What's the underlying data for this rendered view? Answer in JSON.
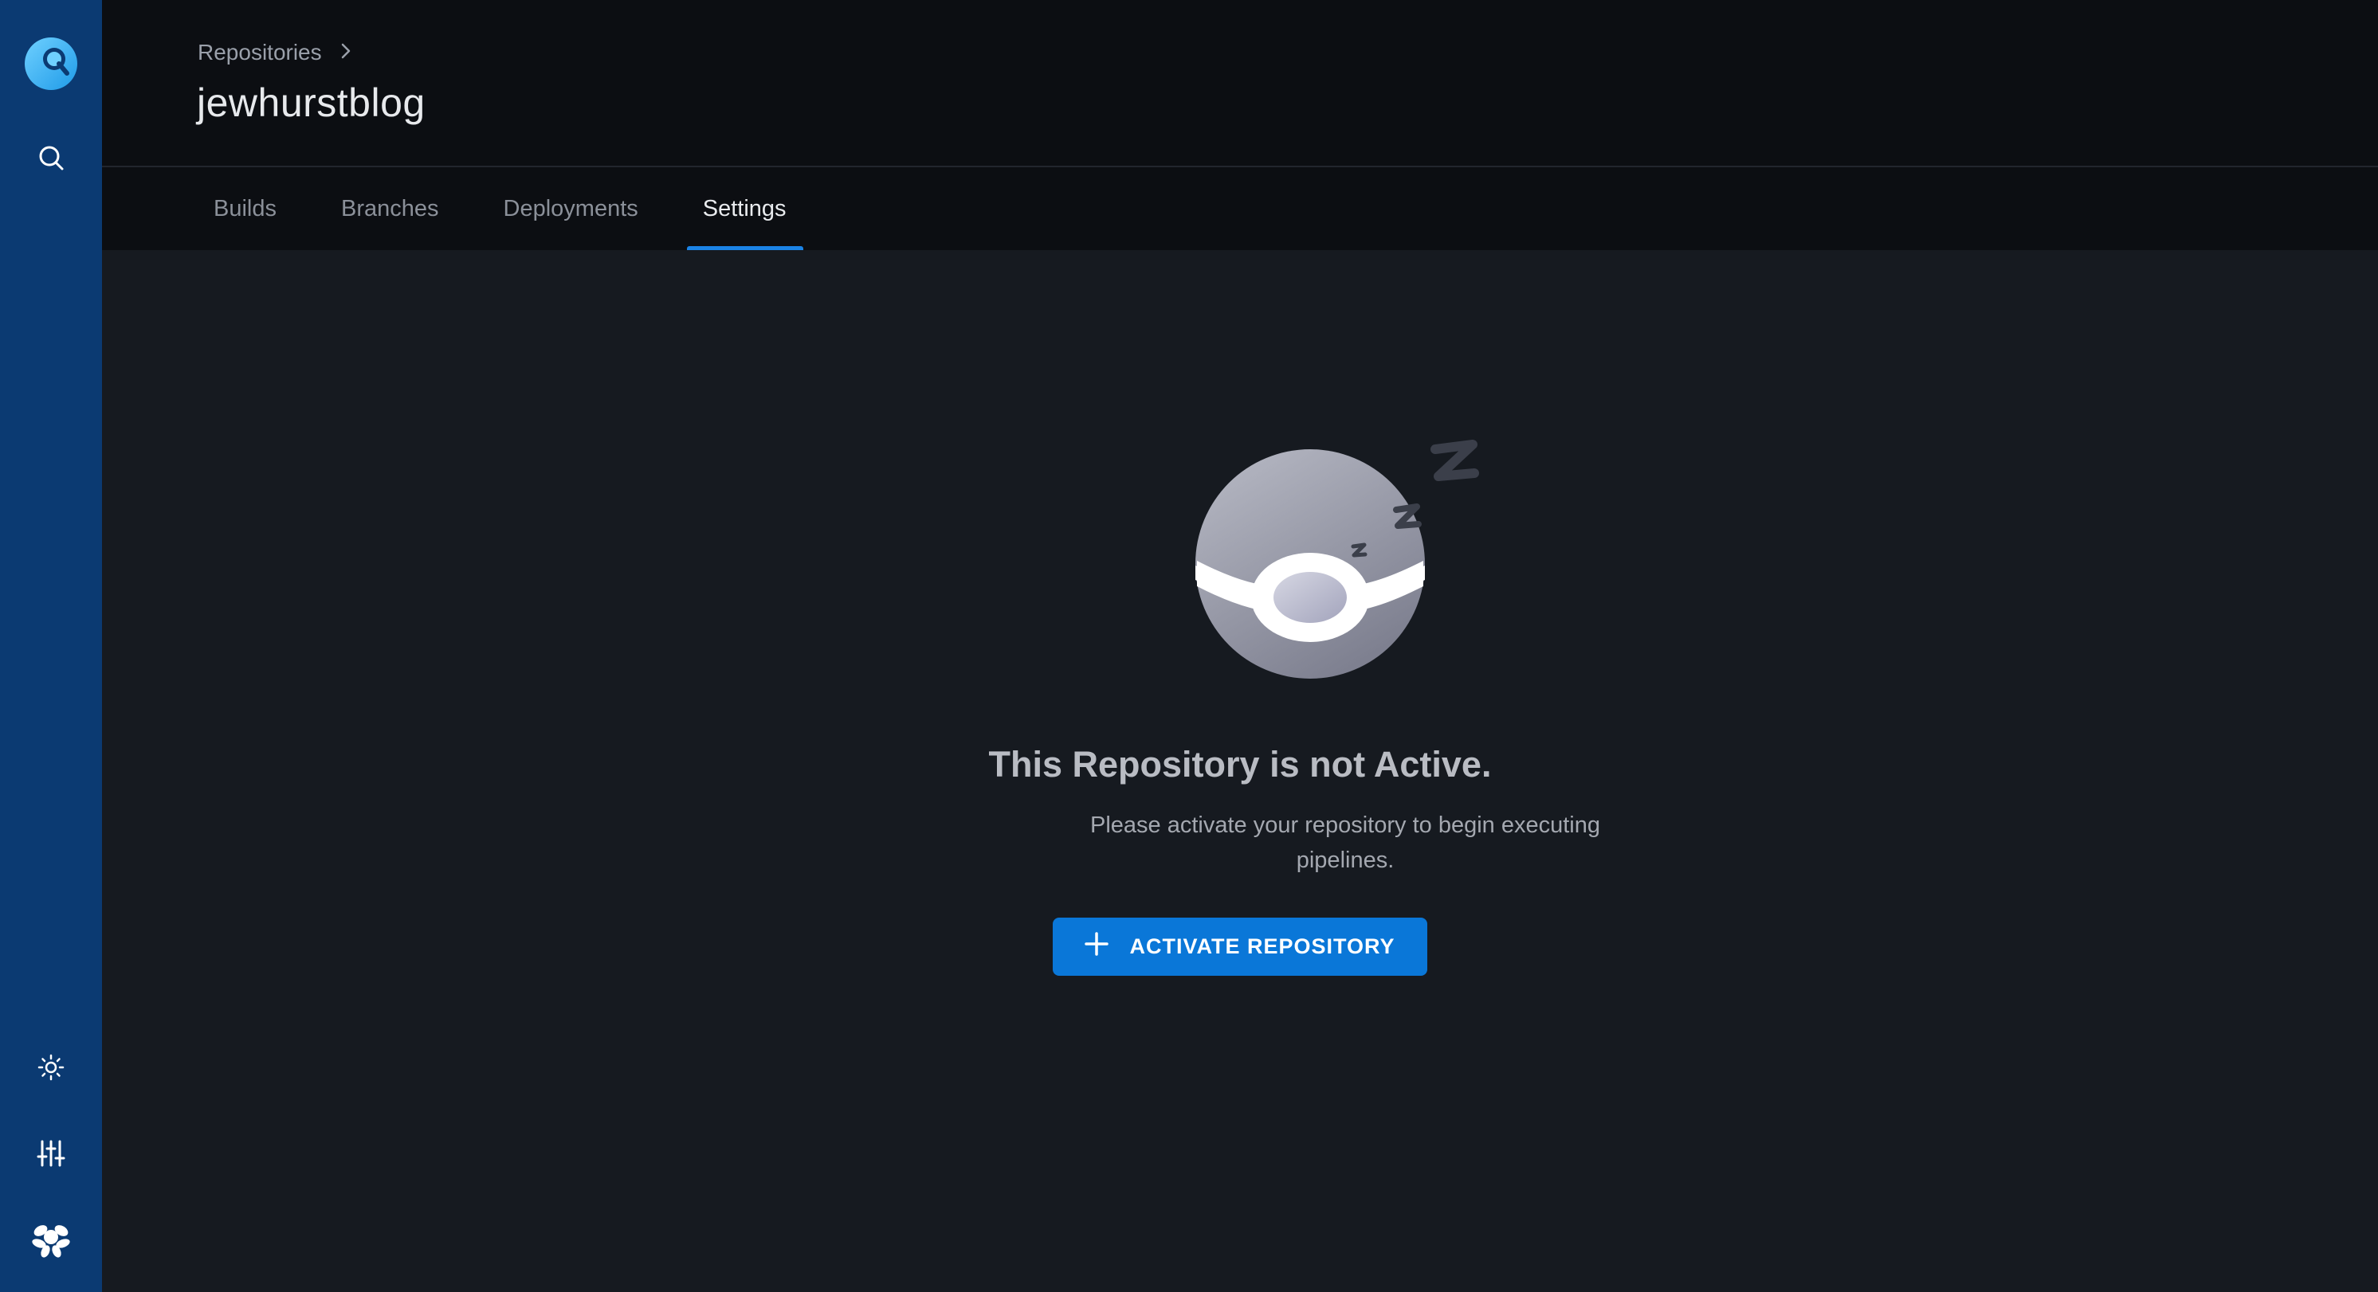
{
  "sidebar": {
    "logo_icon": "drone-logo-icon",
    "search_icon": "search-icon",
    "theme_icon": "sun-icon",
    "settings_icon": "sliders-icon",
    "user_icon": "avatar-icon"
  },
  "header": {
    "breadcrumb": {
      "parent": "Repositories",
      "separator_icon": "chevron-right-icon"
    },
    "title": "jewhurstblog"
  },
  "tabs": [
    {
      "label": "Builds",
      "active": false
    },
    {
      "label": "Branches",
      "active": false
    },
    {
      "label": "Deployments",
      "active": false
    },
    {
      "label": "Settings",
      "active": true
    }
  ],
  "empty_state": {
    "illustration": "sleeping-drone-icon",
    "title": "This Repository is not Active.",
    "description": "Please activate your repository to begin executing pipelines.",
    "button_label": "ACTIVATE REPOSITORY",
    "button_icon": "plus-icon"
  },
  "colors": {
    "sidebar": "#0b3a72",
    "accent": "#0a77d8",
    "tab_underline": "#1b83e6",
    "background": "#161a20",
    "header": "#0c0e12"
  }
}
